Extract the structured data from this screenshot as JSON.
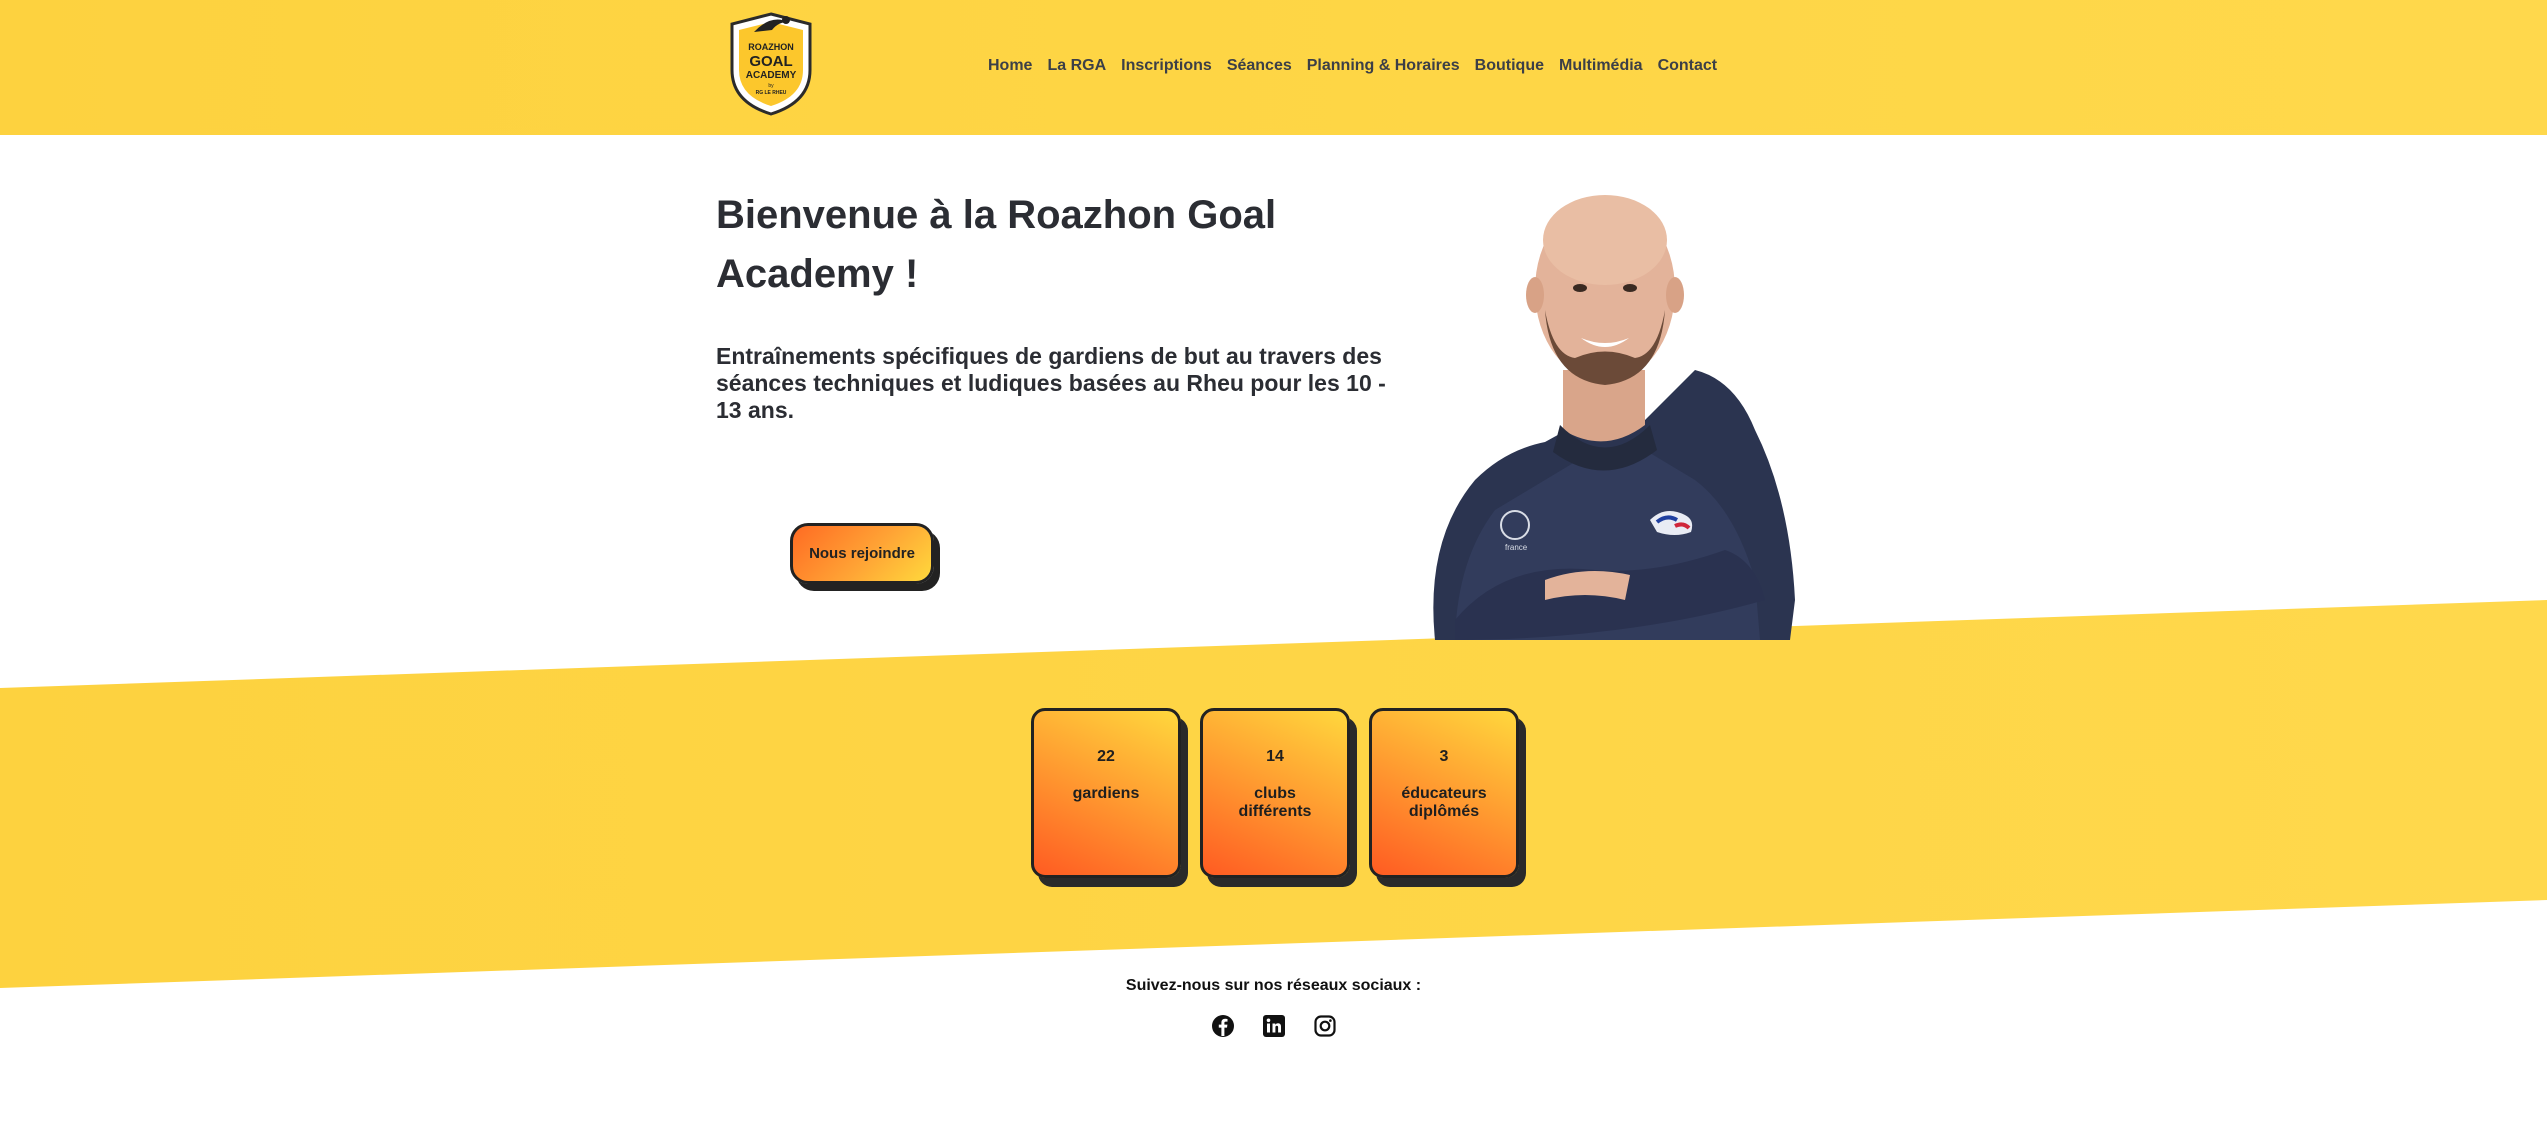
{
  "header": {
    "logo": {
      "text_top": "ROAZHON",
      "text_main_1": "GOAL",
      "text_main_2": "ACADEMY",
      "text_small": "by",
      "text_bottom": "RG LE RHEU"
    },
    "nav": [
      {
        "label": "Home"
      },
      {
        "label": "La RGA"
      },
      {
        "label": "Inscriptions"
      },
      {
        "label": "Séances"
      },
      {
        "label": "Planning & Horaires"
      },
      {
        "label": "Boutique"
      },
      {
        "label": "Multimédia"
      },
      {
        "label": "Contact"
      }
    ]
  },
  "hero": {
    "title": "Bienvenue à la Roazhon Goal Academy !",
    "subtitle": "Entraînements spécifiques de gardiens de but au travers des séances techniques et ludiques basées au Rheu pour les 10 - 13 ans.",
    "cta_label": "Nous rejoindre",
    "person_jacket_text": "france"
  },
  "stats": [
    {
      "value": "22",
      "label": "gardiens"
    },
    {
      "value": "14",
      "label": "clubs différents"
    },
    {
      "value": "3",
      "label": "éducateurs diplômés"
    }
  ],
  "social": {
    "title": "Suivez-nous sur nos réseaux sociaux :",
    "icons": [
      "facebook-icon",
      "linkedin-icon",
      "instagram-icon"
    ]
  },
  "colors": {
    "header_yellow": "#fed646",
    "band_yellow": "#fed443",
    "cta_orange": "#ff6b23",
    "text_dark": "#2b2d33"
  }
}
